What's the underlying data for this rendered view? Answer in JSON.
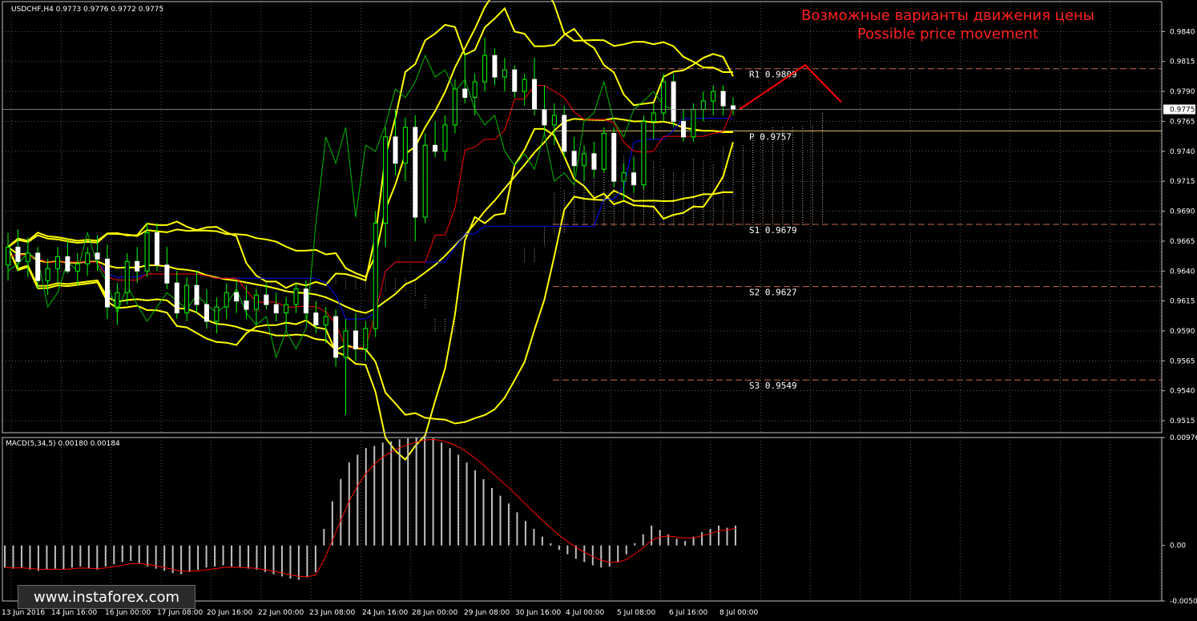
{
  "header": {
    "symbol_info": "USDCHF,H4  0.9773 0.9776 0.9772 0.9775"
  },
  "annotation": {
    "line1": "Возможные варианты движения цены",
    "line2": "Possible price movement",
    "color": "#ff2020"
  },
  "macd_label": "MACD(5,34,5) 0.00180 0.00184",
  "watermark": "www.instaforex.com",
  "chart_data": {
    "type": "candlestick",
    "instrument": "USDCHF",
    "timeframe": "H4",
    "price_axis": {
      "range": [
        0.9505,
        0.9865
      ],
      "ticks": [
        "0.9840",
        "0.9815",
        "0.9790",
        "0.9765",
        "0.9740",
        "0.9715",
        "0.9690",
        "0.9665",
        "0.9640",
        "0.9615",
        "0.9590",
        "0.9565",
        "0.9540",
        "0.9515"
      ],
      "current_price": "0.9775"
    },
    "macd_axis": {
      "range": [
        -0.00502,
        0.00976
      ],
      "ticks": [
        "0.00976",
        "0.00",
        "-0.00502"
      ]
    },
    "time_labels": [
      "13 Jun 2016",
      "14 Jun 16:00",
      "16 Jun 00:00",
      "17 Jun 08:00",
      "20 Jun 16:00",
      "22 Jun 00:00",
      "23 Jun 08:00",
      "24 Jun 16:00",
      "28 Jun 00:00",
      "29 Jun 08:00",
      "30 Jun 16:00",
      "4 Jul 00:00",
      "5 Jul 08:00",
      "6 Jul 16:00",
      "8 Jul 00:00"
    ],
    "pivot_levels": [
      {
        "name": "R1",
        "label": "R1  0.9809",
        "value": 0.9809,
        "color": "#c86a4a"
      },
      {
        "name": "P",
        "label": "P  0.9757",
        "value": 0.9757,
        "color": "#e0c060"
      },
      {
        "name": "S1",
        "label": "S1  0.9679",
        "value": 0.9679,
        "color": "#c86a4a"
      },
      {
        "name": "S2",
        "label": "S2  0.9627",
        "value": 0.9627,
        "color": "#c86a4a"
      },
      {
        "name": "S3",
        "label": "S3  0.9549",
        "value": 0.9549,
        "color": "#c86a4a"
      }
    ],
    "colors": {
      "bull_candle": "#00ff00",
      "bear_candle": "#ffffff",
      "bollinger": "#ffff00",
      "tenkan": "#ff0000",
      "kijun": "#0000ff",
      "chikou": "#00bb00",
      "cloud_a": "#ffe4c4",
      "cloud_b": "#d9b08c",
      "macd_hist": "#c0c0c0",
      "macd_signal": "#ff0000",
      "grid": "#ffffff",
      "forecast": "#ff0000"
    },
    "candles": [
      [
        0.9645,
        0.9672,
        0.9632,
        0.966
      ],
      [
        0.966,
        0.9675,
        0.964,
        0.9648
      ],
      [
        0.9648,
        0.9668,
        0.9635,
        0.9655
      ],
      [
        0.9655,
        0.966,
        0.9625,
        0.9632
      ],
      [
        0.9632,
        0.965,
        0.962,
        0.9642
      ],
      [
        0.9642,
        0.966,
        0.963,
        0.9652
      ],
      [
        0.9652,
        0.9665,
        0.9638,
        0.964
      ],
      [
        0.964,
        0.9655,
        0.9628,
        0.9646
      ],
      [
        0.9646,
        0.966,
        0.9636,
        0.9655
      ],
      [
        0.9655,
        0.967,
        0.964,
        0.965
      ],
      [
        0.965,
        0.9662,
        0.96,
        0.961
      ],
      [
        0.961,
        0.963,
        0.9595,
        0.9622
      ],
      [
        0.9622,
        0.9655,
        0.9612,
        0.9648
      ],
      [
        0.9648,
        0.966,
        0.963,
        0.964
      ],
      [
        0.964,
        0.968,
        0.9635,
        0.9672
      ],
      [
        0.9672,
        0.968,
        0.964,
        0.9645
      ],
      [
        0.9645,
        0.966,
        0.9625,
        0.963
      ],
      [
        0.963,
        0.964,
        0.96,
        0.9605
      ],
      [
        0.9605,
        0.9635,
        0.9598,
        0.9628
      ],
      [
        0.9628,
        0.964,
        0.9605,
        0.9612
      ],
      [
        0.9612,
        0.9625,
        0.9592,
        0.9598
      ],
      [
        0.9598,
        0.9618,
        0.9588,
        0.961
      ],
      [
        0.961,
        0.963,
        0.96,
        0.9622
      ],
      [
        0.9622,
        0.9632,
        0.9605,
        0.9615
      ],
      [
        0.9615,
        0.9628,
        0.96,
        0.9608
      ],
      [
        0.9608,
        0.9625,
        0.9595,
        0.962
      ],
      [
        0.962,
        0.963,
        0.9608,
        0.9612
      ],
      [
        0.9612,
        0.9622,
        0.9598,
        0.9605
      ],
      [
        0.9605,
        0.9618,
        0.959,
        0.9612
      ],
      [
        0.9612,
        0.963,
        0.9605,
        0.9625
      ],
      [
        0.9625,
        0.9632,
        0.96,
        0.9605
      ],
      [
        0.9605,
        0.9615,
        0.9588,
        0.9595
      ],
      [
        0.9595,
        0.961,
        0.958,
        0.9602
      ],
      [
        0.9602,
        0.9608,
        0.956,
        0.9568
      ],
      [
        0.9568,
        0.96,
        0.952,
        0.959
      ],
      [
        0.959,
        0.9605,
        0.9565,
        0.9575
      ],
      [
        0.9575,
        0.9598,
        0.9565,
        0.9592
      ],
      [
        0.9592,
        0.969,
        0.9585,
        0.968
      ],
      [
        0.968,
        0.976,
        0.966,
        0.9752
      ],
      [
        0.9752,
        0.9775,
        0.972,
        0.973
      ],
      [
        0.973,
        0.9768,
        0.9715,
        0.976
      ],
      [
        0.976,
        0.977,
        0.9665,
        0.9685
      ],
      [
        0.9685,
        0.9755,
        0.968,
        0.9745
      ],
      [
        0.9745,
        0.9765,
        0.9735,
        0.974
      ],
      [
        0.974,
        0.977,
        0.9732,
        0.9762
      ],
      [
        0.9762,
        0.98,
        0.9755,
        0.9792
      ],
      [
        0.9792,
        0.9822,
        0.978,
        0.9785
      ],
      [
        0.9785,
        0.9805,
        0.977,
        0.9798
      ],
      [
        0.9798,
        0.9835,
        0.979,
        0.982
      ],
      [
        0.982,
        0.9826,
        0.9795,
        0.9802
      ],
      [
        0.9802,
        0.9818,
        0.979,
        0.9808
      ],
      [
        0.9808,
        0.9812,
        0.9785,
        0.979
      ],
      [
        0.979,
        0.9805,
        0.9778,
        0.98
      ],
      [
        0.98,
        0.9818,
        0.977,
        0.9775
      ],
      [
        0.9775,
        0.9795,
        0.9755,
        0.9762
      ],
      [
        0.9762,
        0.978,
        0.9745,
        0.977
      ],
      [
        0.977,
        0.9778,
        0.9735,
        0.974
      ],
      [
        0.974,
        0.9752,
        0.972,
        0.9728
      ],
      [
        0.9728,
        0.9745,
        0.9715,
        0.9738
      ],
      [
        0.9738,
        0.9748,
        0.9718,
        0.9725
      ],
      [
        0.9725,
        0.976,
        0.9722,
        0.9755
      ],
      [
        0.9755,
        0.976,
        0.971,
        0.9715
      ],
      [
        0.9715,
        0.973,
        0.97,
        0.9722
      ],
      [
        0.9722,
        0.9735,
        0.9705,
        0.9712
      ],
      [
        0.9712,
        0.977,
        0.9708,
        0.9765
      ],
      [
        0.9765,
        0.978,
        0.975,
        0.9772
      ],
      [
        0.9772,
        0.9805,
        0.9765,
        0.9798
      ],
      [
        0.9798,
        0.9805,
        0.976,
        0.9765
      ],
      [
        0.9765,
        0.9775,
        0.9748,
        0.9752
      ],
      [
        0.9752,
        0.978,
        0.9748,
        0.9775
      ],
      [
        0.9775,
        0.979,
        0.9765,
        0.9782
      ],
      [
        0.9782,
        0.9795,
        0.977,
        0.979
      ],
      [
        0.979,
        0.9795,
        0.977,
        0.9778
      ],
      [
        0.9778,
        0.9785,
        0.977,
        0.9775
      ]
    ],
    "macd_hist": [
      -0.002,
      -0.0021,
      -0.002,
      -0.0022,
      -0.0023,
      -0.0022,
      -0.0021,
      -0.0022,
      -0.002,
      -0.0019,
      -0.0021,
      -0.0022,
      -0.0019,
      -0.0017,
      -0.0015,
      -0.0014,
      -0.0016,
      -0.0019,
      -0.0021,
      -0.0023,
      -0.0025,
      -0.0026,
      -0.0024,
      -0.0022,
      -0.002,
      -0.0019,
      -0.0018,
      -0.0019,
      -0.002,
      -0.0021,
      -0.0022,
      -0.0024,
      -0.0026,
      -0.0028,
      -0.003,
      -0.0031,
      -0.0029,
      -0.0024,
      0.0015,
      0.004,
      0.006,
      0.0075,
      0.0082,
      0.0088,
      0.009,
      0.0093,
      0.0094,
      0.0096,
      0.0097,
      0.0098,
      0.0099,
      0.0097,
      0.0093,
      0.0088,
      0.0082,
      0.0075,
      0.0068,
      0.006,
      0.0052,
      0.0045,
      0.0038,
      0.003,
      0.0022,
      0.0015,
      0.0008,
      0.0002,
      -0.0004,
      -0.0008,
      -0.0012,
      -0.0015,
      -0.0018,
      -0.002,
      -0.0019,
      -0.0015,
      -0.0008,
      0.0002,
      0.001,
      0.0018,
      0.0014,
      0.001,
      0.0006,
      0.0004,
      0.0008,
      0.0012,
      0.0015,
      0.0018,
      0.0016,
      0.0018
    ]
  }
}
